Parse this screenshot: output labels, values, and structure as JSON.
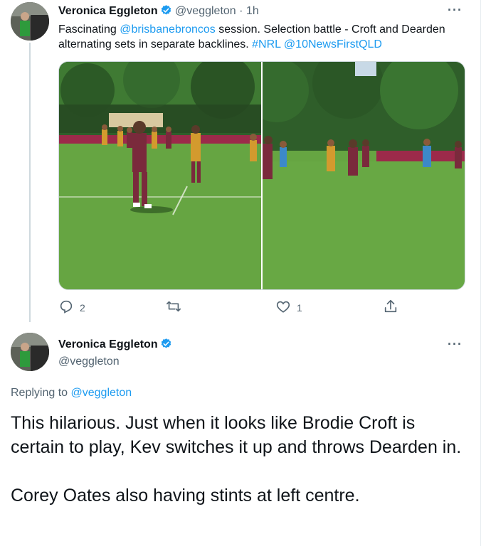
{
  "tweet1": {
    "name": "Veronica Eggleton",
    "handle": "@veggleton",
    "separator": "·",
    "time": "1h",
    "more": "···",
    "text_parts": {
      "t1": "Fascinating ",
      "l1": "@brisbanebroncos",
      "t2": " session. Selection battle - Croft and Dearden alternating sets in separate backlines. ",
      "l2": "#NRL",
      "t3": " ",
      "l3": "@10NewsFirstQLD"
    },
    "actions": {
      "reply_count": "2",
      "retweet_count": "",
      "like_count": "1"
    }
  },
  "tweet2": {
    "name": "Veronica Eggleton",
    "handle": "@veggleton",
    "more": "···",
    "replying_prefix": "Replying to ",
    "replying_handle": "@veggleton",
    "paragraph1": "This hilarious. Just when it looks like Brodie Croft is certain to play, Kev switches it up and throws Dearden in.",
    "paragraph2": "Corey Oates also having stints at left centre."
  },
  "colors": {
    "link": "#1d9bf0",
    "muted": "#536471",
    "verified": "#1d9bf0",
    "grass": "#5f9c3c",
    "jersey_maroon": "#7a2a3c",
    "jersey_gold": "#d39a2e"
  },
  "icons": [
    "verified-badge-icon",
    "more-icon",
    "reply-icon",
    "retweet-icon",
    "like-icon",
    "share-icon"
  ]
}
